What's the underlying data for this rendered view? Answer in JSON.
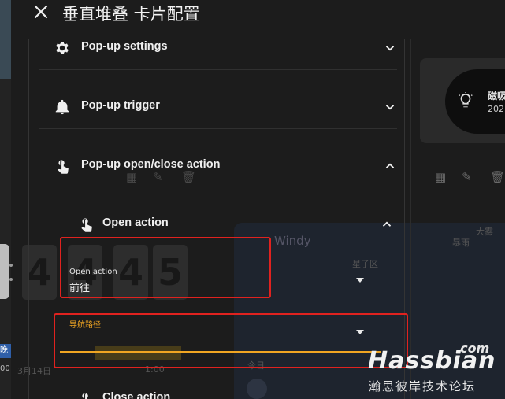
{
  "dialog": {
    "title": "垂直堆叠 卡片配置"
  },
  "sections": {
    "popup_settings": "Pop-up settings",
    "popup_trigger": "Pop-up trigger",
    "popup_open_close": "Pop-up open/close action",
    "open_action": "Open action",
    "close_action": "Close action"
  },
  "open_action_field": {
    "label": "Open action",
    "value": "前往"
  },
  "navigation_field": {
    "label": "导航路径",
    "value": ""
  },
  "background": {
    "right_card_name": "磁吸",
    "right_card_number": "202",
    "weather_title": "Windy",
    "left_badge": "晚",
    "left_time": "00",
    "flip_digits": [
      "4",
      "4",
      "4",
      "5"
    ],
    "faint_labels": [
      "大雾",
      "暴雨",
      "星子区",
      "1:00",
      "今日",
      "3月14日"
    ]
  },
  "watermark": {
    "com": ".com",
    "main": "Hassbian",
    "sub": "瀚思彼岸技术论坛"
  },
  "colors": {
    "accent_orange": "#f0a522",
    "highlight_red": "#e0221f"
  }
}
